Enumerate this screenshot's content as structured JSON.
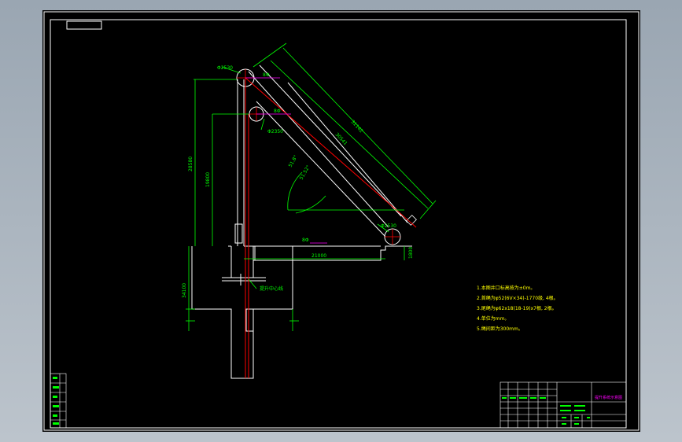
{
  "drawing": {
    "dimensions": {
      "d1": "Φ2530",
      "d2": "Φ2350",
      "d3": "Φ2530",
      "long_outer": "31142",
      "long_inner": "30541",
      "vertical_total": "28580",
      "vertical_inner": "19800",
      "bottom_left": "34100",
      "horizontal": "21000",
      "right_small": "1800",
      "angle1": "51.8°",
      "angle2": "51.52°",
      "tag1": "8Φ",
      "tag2": "8Φ",
      "tag3": "8Φ"
    },
    "centerline_label": "提升中心线",
    "notes": [
      "1.本图井口标高按为±0m。",
      "2.首绳为φ52(6V×34)-1770级, 4根。",
      "3.尾绳为φ62x18(18-19)x7根, 2根。",
      "4.单位为mm。",
      "5.绳间距为300mm。"
    ],
    "title_block": {
      "drawing_name": "提升系统示意图"
    },
    "left_strip": [
      "",
      "",
      "",
      "",
      "",
      ""
    ]
  },
  "colors": {
    "background": "#000000",
    "border": "#ffffff",
    "dimension": "#00ff00",
    "centerline": "#ff0000",
    "annotation": "#ff00ff",
    "notes": "#ffff00"
  }
}
